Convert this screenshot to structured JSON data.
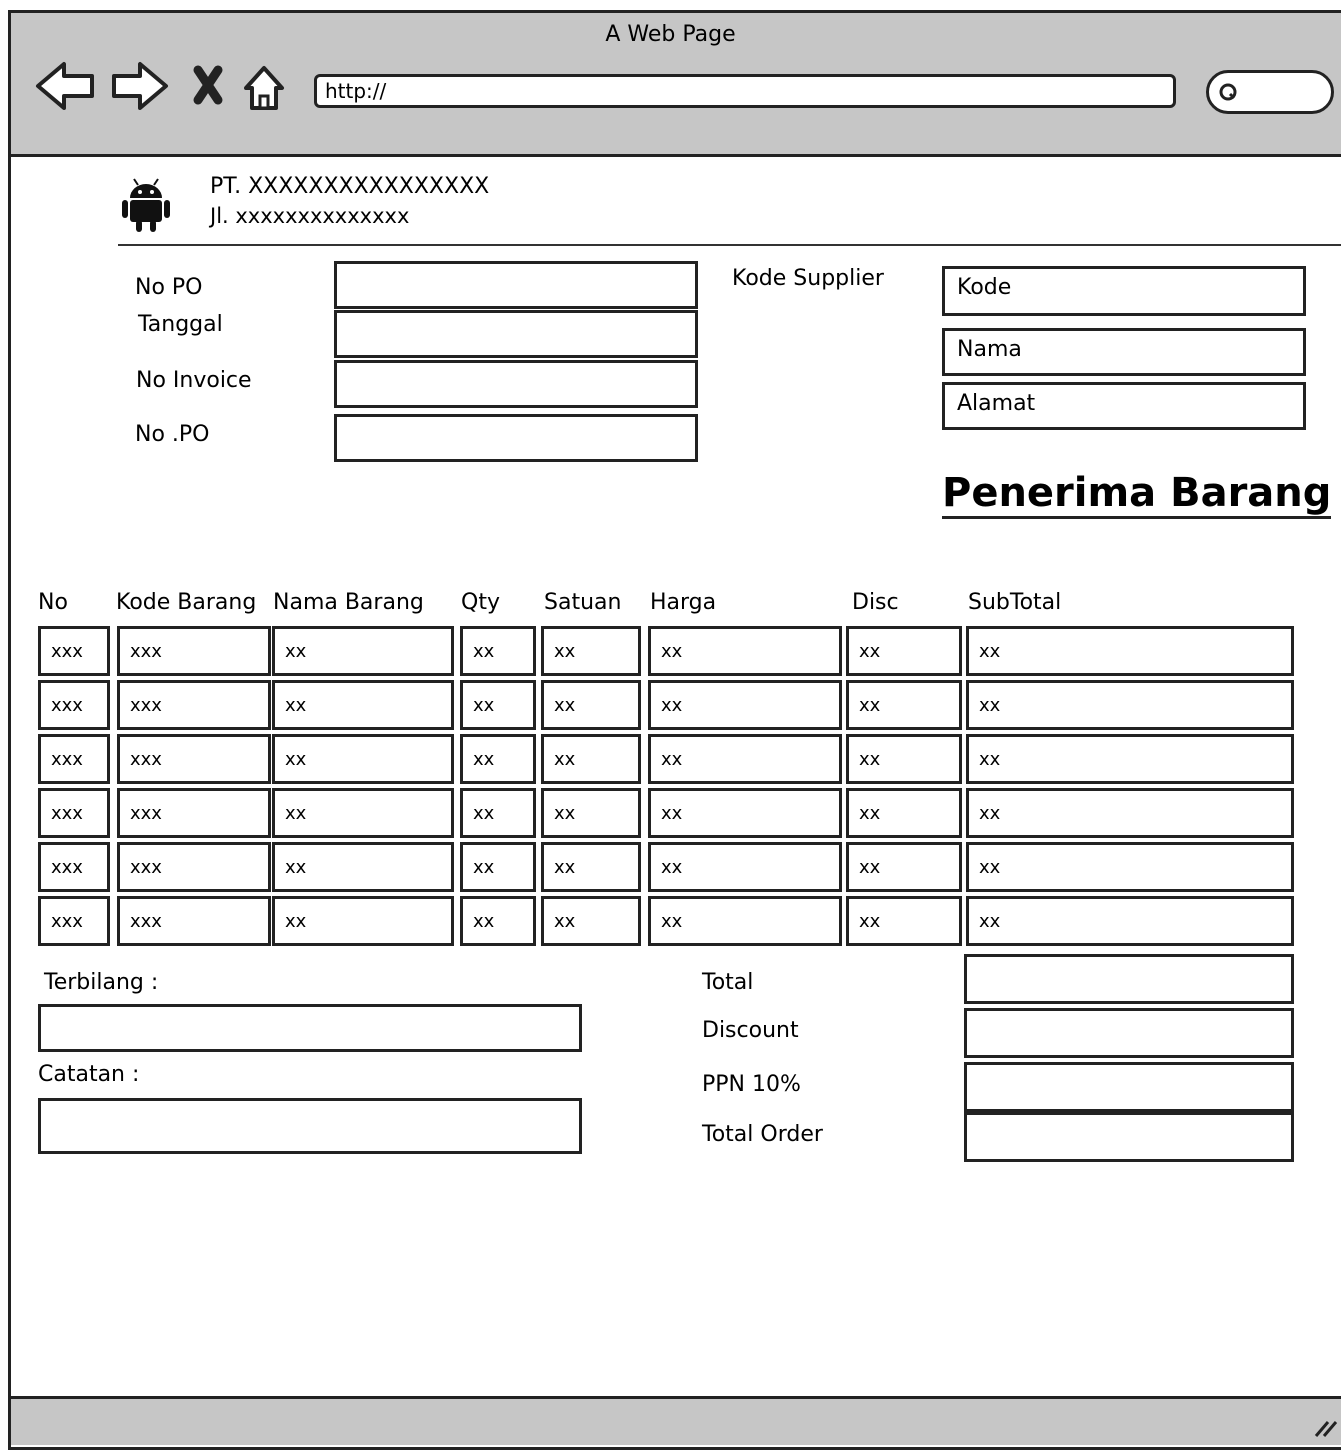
{
  "browser": {
    "title": "A Web Page",
    "url": "http://"
  },
  "company": {
    "name": "PT. XXXXXXXXXXXXXXXX",
    "address": "Jl. xxxxxxxxxxxxxx"
  },
  "form": {
    "no_po_label": "No PO",
    "tanggal_label": "Tanggal",
    "no_invoice_label": "No Invoice",
    "no_po2_label": "No .PO",
    "kode_supplier_label": "Kode Supplier",
    "supplier_kode": "Kode",
    "supplier_nama": "Nama",
    "supplier_alamat": "Alamat"
  },
  "heading": "Penerima Barang",
  "table": {
    "headers": [
      "No",
      "Kode Barang",
      "Nama Barang",
      "Qty",
      "Satuan",
      "Harga",
      "Disc",
      "SubTotal"
    ],
    "rows": [
      [
        "xxx",
        "xxx",
        "xx",
        "xx",
        "xx",
        "xx",
        "xx",
        "xx"
      ],
      [
        "xxx",
        "xxx",
        "xx",
        "xx",
        "xx",
        "xx",
        "xx",
        "xx"
      ],
      [
        "xxx",
        "xxx",
        "xx",
        "xx",
        "xx",
        "xx",
        "xx",
        "xx"
      ],
      [
        "xxx",
        "xxx",
        "xx",
        "xx",
        "xx",
        "xx",
        "xx",
        "xx"
      ],
      [
        "xxx",
        "xxx",
        "xx",
        "xx",
        "xx",
        "xx",
        "xx",
        "xx"
      ],
      [
        "xxx",
        "xxx",
        "xx",
        "xx",
        "xx",
        "xx",
        "xx",
        "xx"
      ]
    ]
  },
  "footer": {
    "terbilang_label": "Terbilang :",
    "catatan_label": "Catatan :",
    "total_label": "Total",
    "discount_label": "Discount",
    "ppn_label": "PPN 10%",
    "total_order_label": "Total Order"
  }
}
